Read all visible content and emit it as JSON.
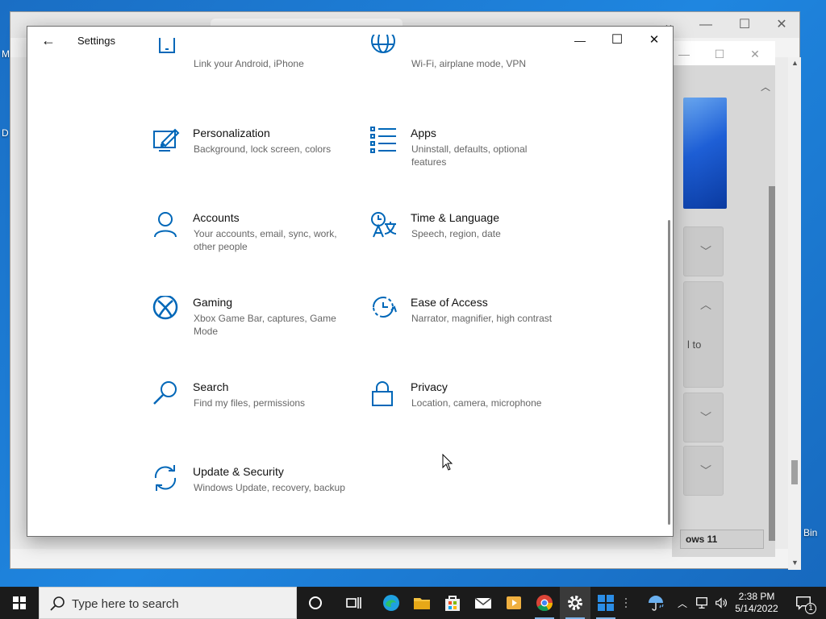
{
  "desktop": {
    "left_labels": [
      "M",
      "D"
    ],
    "right_label": "Bin"
  },
  "background_window": {
    "button_label": "ows 11",
    "partial_text": "l to"
  },
  "settings": {
    "title": "Settings",
    "back_glyph": "←",
    "minimize_glyph": "—",
    "maximize_glyph": "☐",
    "close_glyph": "✕",
    "items": [
      {
        "title": "",
        "desc": "Link your Android, iPhone",
        "icon": "phone-icon"
      },
      {
        "title": "",
        "desc": "Wi-Fi, airplane mode, VPN",
        "icon": "globe-icon"
      },
      {
        "title": "Personalization",
        "desc": "Background, lock screen, colors",
        "icon": "personalization-icon"
      },
      {
        "title": "Apps",
        "desc": "Uninstall, defaults, optional features",
        "icon": "apps-icon"
      },
      {
        "title": "Accounts",
        "desc": "Your accounts, email, sync, work, other people",
        "icon": "person-icon"
      },
      {
        "title": "Time & Language",
        "desc": "Speech, region, date",
        "icon": "time-language-icon"
      },
      {
        "title": "Gaming",
        "desc": "Xbox Game Bar, captures, Game Mode",
        "icon": "xbox-icon"
      },
      {
        "title": "Ease of Access",
        "desc": "Narrator, magnifier, high contrast",
        "icon": "ease-of-access-icon"
      },
      {
        "title": "Search",
        "desc": "Find my files, permissions",
        "icon": "search-icon"
      },
      {
        "title": "Privacy",
        "desc": "Location, camera, microphone",
        "icon": "lock-icon"
      },
      {
        "title": "Update & Security",
        "desc": "Windows Update, recovery, backup",
        "icon": "sync-icon"
      }
    ],
    "accent_color": "#0067b8"
  },
  "taskbar": {
    "search_placeholder": "Type here to search",
    "time": "2:38 PM",
    "date": "5/14/2022",
    "notification_count": "1"
  }
}
